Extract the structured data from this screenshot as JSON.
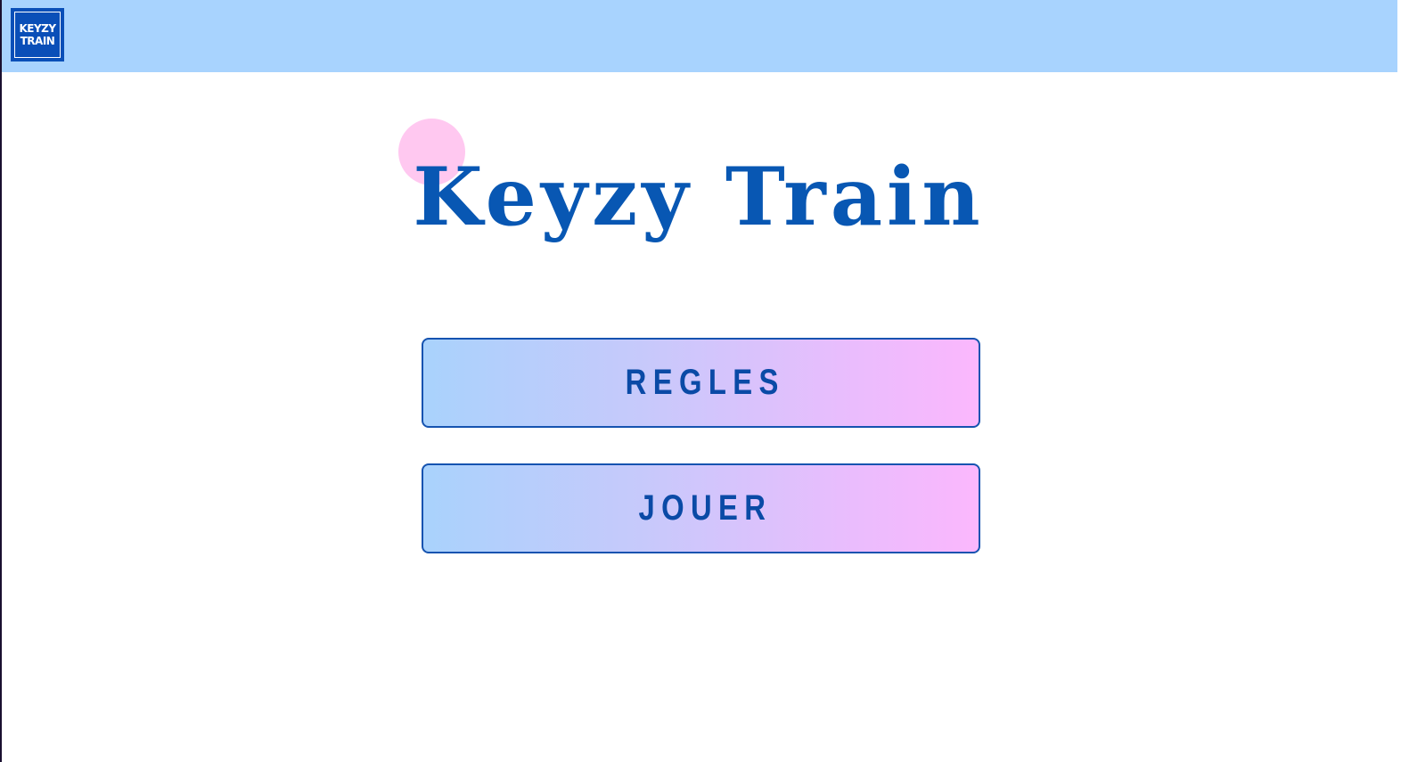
{
  "header": {
    "logo": {
      "line1": "KEYZY",
      "line2": "TRAIN"
    }
  },
  "main": {
    "title": "Keyzy Train",
    "buttons": {
      "rules_label": "REGLES",
      "play_label": "JOUER"
    }
  },
  "colors": {
    "header_background": "#a8d3fe",
    "brand_blue": "#0857b3",
    "accent_pink": "#ffc8f0",
    "button_gradient_start": "#a9d2fc",
    "button_gradient_end": "#fbb7fd"
  }
}
